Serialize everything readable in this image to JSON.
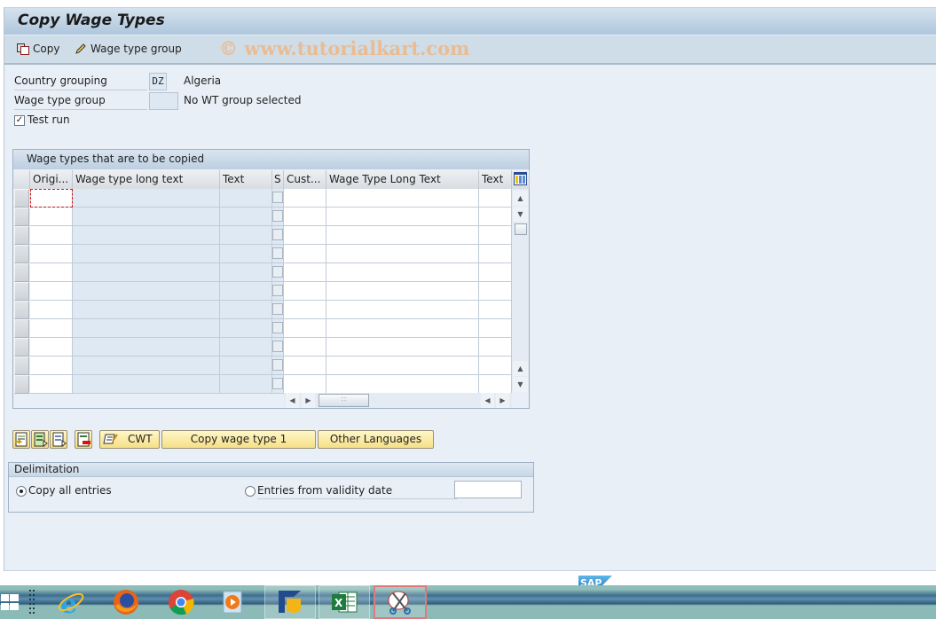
{
  "window": {
    "title": "Copy Wage Types"
  },
  "toolbar": {
    "copy_label": "Copy",
    "wage_type_group_label": "Wage type group",
    "watermark": "© www.tutorialkart.com"
  },
  "form": {
    "country_grouping": {
      "label": "Country grouping",
      "value": "DZ",
      "description": "Algeria"
    },
    "wage_type_group": {
      "label": "Wage type group",
      "value": "",
      "description": "No WT group selected"
    },
    "test_run": {
      "label": "Test run",
      "checked": true
    }
  },
  "table": {
    "title": "Wage types that are to be copied",
    "columns": [
      "Origi...",
      "Wage type long text",
      "Text",
      "S",
      "Cust...",
      "Wage Type Long Text",
      "Text"
    ],
    "row_count": 11,
    "rows": []
  },
  "buttons": {
    "cwt_label": "CWT",
    "copy_wage_type_label": "Copy wage type 1",
    "other_languages_label": "Other Languages"
  },
  "delimitation": {
    "title": "Delimitation",
    "option_all": "Copy all entries",
    "option_validity": "Entries from validity date",
    "selected": "all",
    "validity_date": ""
  },
  "taskbar": {
    "apps": [
      "start",
      "task-view",
      "internet-explorer",
      "firefox",
      "chrome",
      "media-player",
      "sap-logon",
      "excel",
      "snipping-tool"
    ]
  },
  "brand": {
    "sap_logo": "SAP",
    "accent": "#f4dc7b"
  }
}
